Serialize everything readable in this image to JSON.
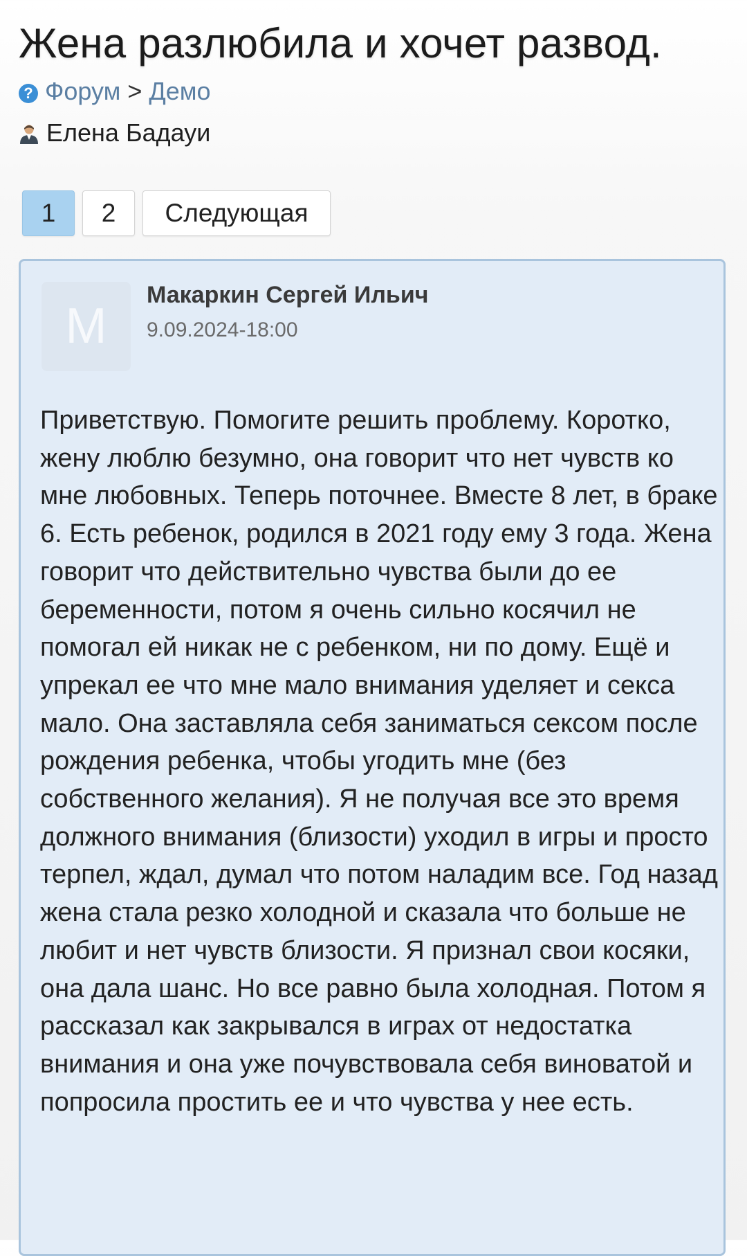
{
  "page": {
    "title": "Жена разлюбила и хочет развод."
  },
  "breadcrumb": {
    "icon": "question-circle-icon",
    "items": [
      {
        "label": "Форум"
      },
      {
        "label": "Демо"
      }
    ],
    "separator": ">"
  },
  "topic_author": {
    "icon": "user-icon",
    "name": "Елена Бадауи"
  },
  "pagination": {
    "pages": [
      {
        "label": "1",
        "active": true
      },
      {
        "label": "2",
        "active": false
      }
    ],
    "next_label": "Следующая"
  },
  "post": {
    "avatar_letter": "М",
    "author": "Макаркин Сергей Ильич",
    "date": "9.09.2024-18:00",
    "body": "Приветствую. Помогите решить проблему. Коротко, жену люблю безумно, она говорит что нет чувств ко мне любовных. Теперь поточнее. Вместе 8 лет, в браке 6. Есть ребенок, родился в 2021 году ему 3 года. Жена говорит что действительно чувства были до ее беременности, потом я очень сильно косячил не помогал ей никак не с ребенком, ни по дому. Ещё и упрекал ее что мне мало внимания уделяет и секса мало. Она заставляла себя заниматься сексом после рождения ребенка, чтобы угодить мне (без собственного желания). Я не получая все это время должного внимания (близости) уходил в игры и просто терпел, ждал, думал что потом наладим все. Год назад жена стала резко холодной и сказала что больше не любит и нет чувств близости. Я признал свои косяки, она дала шанс. Но все равно была холодная. Потом я рассказал как закрывался в играх от недостатка внимания и она уже почувствовала себя виноватой и попросила простить ее и что чувства у нее есть."
  },
  "colors": {
    "post_background": "#e2ecf7",
    "post_border": "#a9c4dd",
    "active_page": "#a9d2f0",
    "link": "#5b7fa3",
    "help_icon": "#3b8fd6"
  }
}
